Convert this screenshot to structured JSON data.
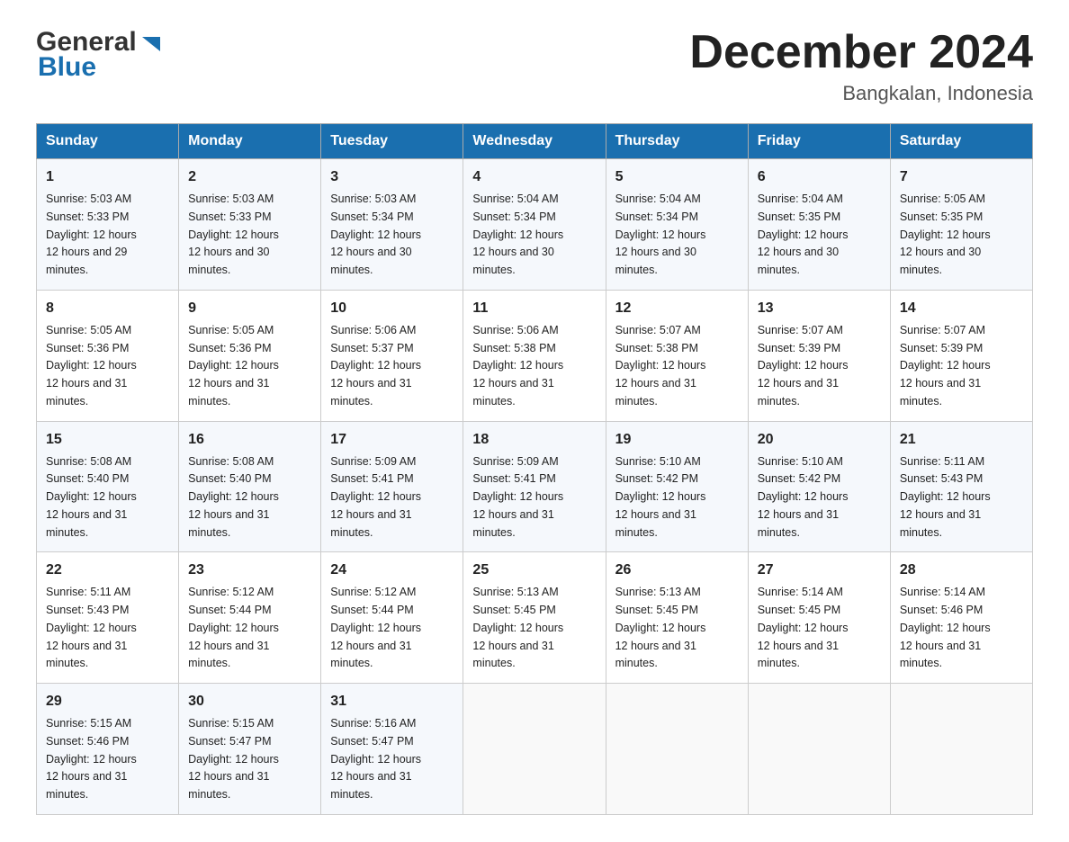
{
  "header": {
    "logo_general": "General",
    "logo_blue": "Blue",
    "month_title": "December 2024",
    "location": "Bangkalan, Indonesia"
  },
  "days_of_week": [
    "Sunday",
    "Monday",
    "Tuesday",
    "Wednesday",
    "Thursday",
    "Friday",
    "Saturday"
  ],
  "weeks": [
    [
      {
        "day": "1",
        "sunrise": "5:03 AM",
        "sunset": "5:33 PM",
        "daylight": "12 hours and 29 minutes."
      },
      {
        "day": "2",
        "sunrise": "5:03 AM",
        "sunset": "5:33 PM",
        "daylight": "12 hours and 30 minutes."
      },
      {
        "day": "3",
        "sunrise": "5:03 AM",
        "sunset": "5:34 PM",
        "daylight": "12 hours and 30 minutes."
      },
      {
        "day": "4",
        "sunrise": "5:04 AM",
        "sunset": "5:34 PM",
        "daylight": "12 hours and 30 minutes."
      },
      {
        "day": "5",
        "sunrise": "5:04 AM",
        "sunset": "5:34 PM",
        "daylight": "12 hours and 30 minutes."
      },
      {
        "day": "6",
        "sunrise": "5:04 AM",
        "sunset": "5:35 PM",
        "daylight": "12 hours and 30 minutes."
      },
      {
        "day": "7",
        "sunrise": "5:05 AM",
        "sunset": "5:35 PM",
        "daylight": "12 hours and 30 minutes."
      }
    ],
    [
      {
        "day": "8",
        "sunrise": "5:05 AM",
        "sunset": "5:36 PM",
        "daylight": "12 hours and 31 minutes."
      },
      {
        "day": "9",
        "sunrise": "5:05 AM",
        "sunset": "5:36 PM",
        "daylight": "12 hours and 31 minutes."
      },
      {
        "day": "10",
        "sunrise": "5:06 AM",
        "sunset": "5:37 PM",
        "daylight": "12 hours and 31 minutes."
      },
      {
        "day": "11",
        "sunrise": "5:06 AM",
        "sunset": "5:38 PM",
        "daylight": "12 hours and 31 minutes."
      },
      {
        "day": "12",
        "sunrise": "5:07 AM",
        "sunset": "5:38 PM",
        "daylight": "12 hours and 31 minutes."
      },
      {
        "day": "13",
        "sunrise": "5:07 AM",
        "sunset": "5:39 PM",
        "daylight": "12 hours and 31 minutes."
      },
      {
        "day": "14",
        "sunrise": "5:07 AM",
        "sunset": "5:39 PM",
        "daylight": "12 hours and 31 minutes."
      }
    ],
    [
      {
        "day": "15",
        "sunrise": "5:08 AM",
        "sunset": "5:40 PM",
        "daylight": "12 hours and 31 minutes."
      },
      {
        "day": "16",
        "sunrise": "5:08 AM",
        "sunset": "5:40 PM",
        "daylight": "12 hours and 31 minutes."
      },
      {
        "day": "17",
        "sunrise": "5:09 AM",
        "sunset": "5:41 PM",
        "daylight": "12 hours and 31 minutes."
      },
      {
        "day": "18",
        "sunrise": "5:09 AM",
        "sunset": "5:41 PM",
        "daylight": "12 hours and 31 minutes."
      },
      {
        "day": "19",
        "sunrise": "5:10 AM",
        "sunset": "5:42 PM",
        "daylight": "12 hours and 31 minutes."
      },
      {
        "day": "20",
        "sunrise": "5:10 AM",
        "sunset": "5:42 PM",
        "daylight": "12 hours and 31 minutes."
      },
      {
        "day": "21",
        "sunrise": "5:11 AM",
        "sunset": "5:43 PM",
        "daylight": "12 hours and 31 minutes."
      }
    ],
    [
      {
        "day": "22",
        "sunrise": "5:11 AM",
        "sunset": "5:43 PM",
        "daylight": "12 hours and 31 minutes."
      },
      {
        "day": "23",
        "sunrise": "5:12 AM",
        "sunset": "5:44 PM",
        "daylight": "12 hours and 31 minutes."
      },
      {
        "day": "24",
        "sunrise": "5:12 AM",
        "sunset": "5:44 PM",
        "daylight": "12 hours and 31 minutes."
      },
      {
        "day": "25",
        "sunrise": "5:13 AM",
        "sunset": "5:45 PM",
        "daylight": "12 hours and 31 minutes."
      },
      {
        "day": "26",
        "sunrise": "5:13 AM",
        "sunset": "5:45 PM",
        "daylight": "12 hours and 31 minutes."
      },
      {
        "day": "27",
        "sunrise": "5:14 AM",
        "sunset": "5:45 PM",
        "daylight": "12 hours and 31 minutes."
      },
      {
        "day": "28",
        "sunrise": "5:14 AM",
        "sunset": "5:46 PM",
        "daylight": "12 hours and 31 minutes."
      }
    ],
    [
      {
        "day": "29",
        "sunrise": "5:15 AM",
        "sunset": "5:46 PM",
        "daylight": "12 hours and 31 minutes."
      },
      {
        "day": "30",
        "sunrise": "5:15 AM",
        "sunset": "5:47 PM",
        "daylight": "12 hours and 31 minutes."
      },
      {
        "day": "31",
        "sunrise": "5:16 AM",
        "sunset": "5:47 PM",
        "daylight": "12 hours and 31 minutes."
      },
      null,
      null,
      null,
      null
    ]
  ]
}
